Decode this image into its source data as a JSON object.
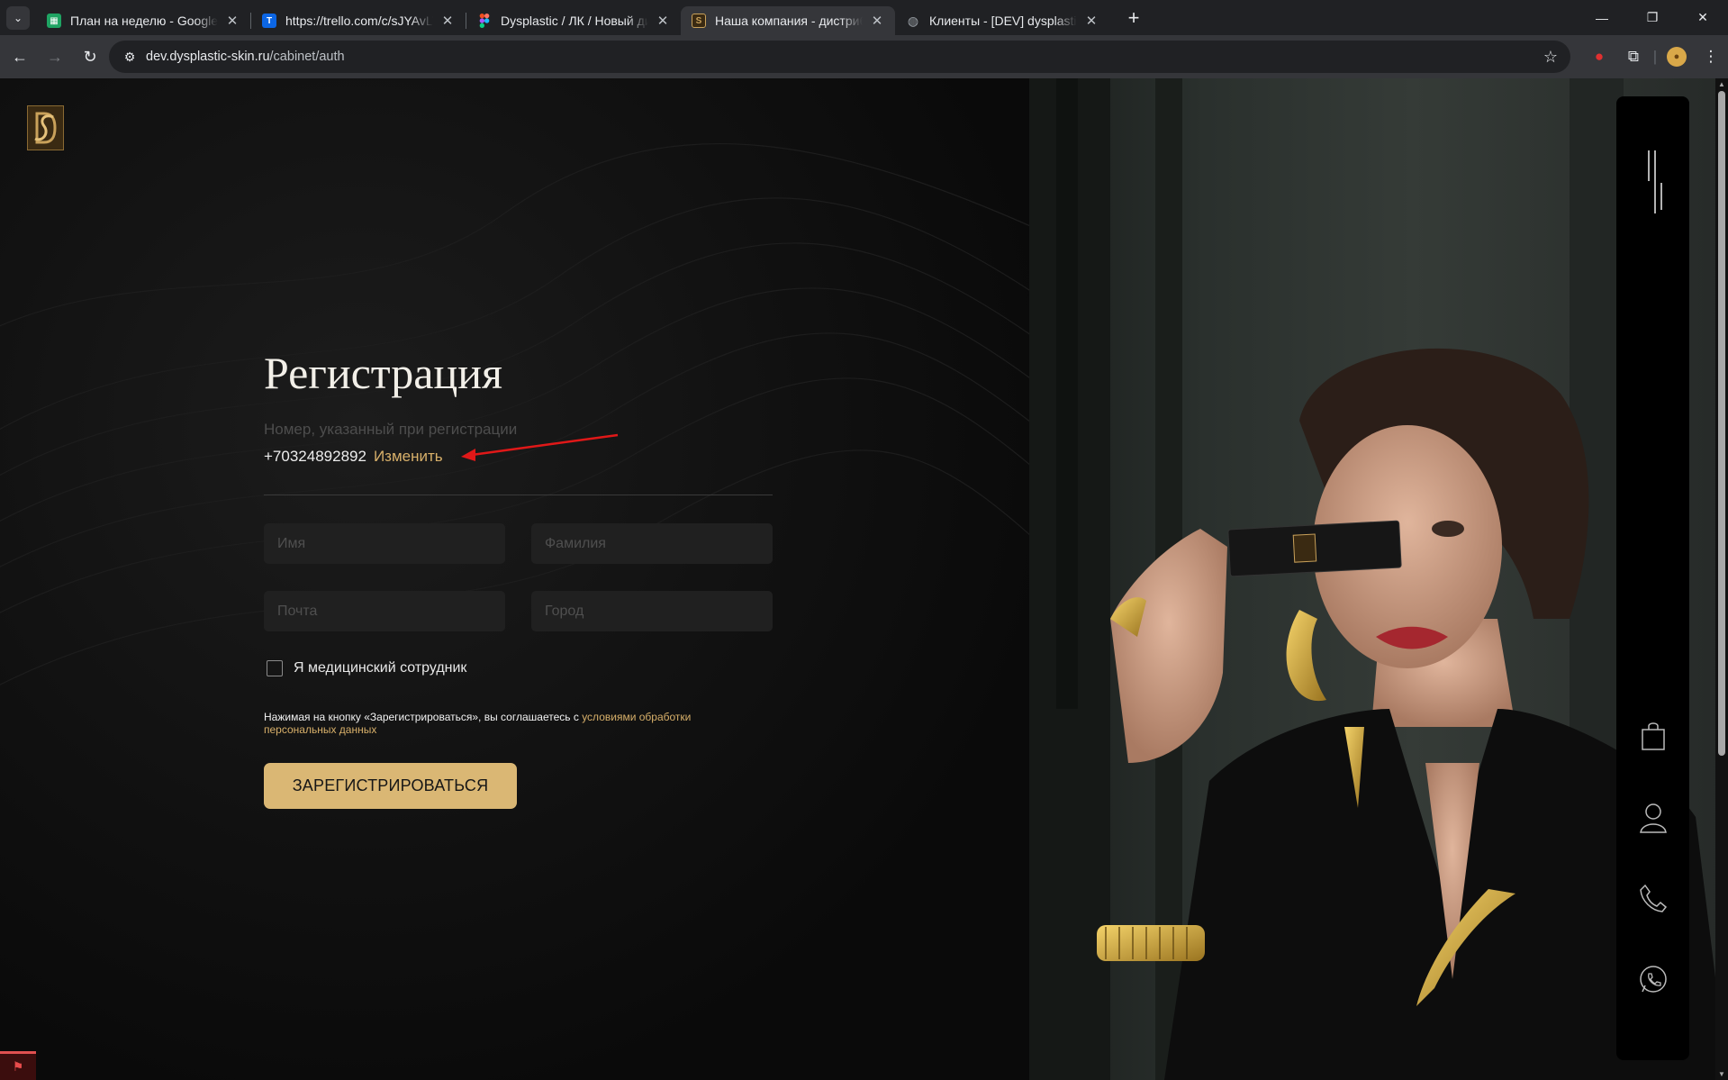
{
  "browser": {
    "tabs": [
      {
        "title": "План на неделю - Google Табл",
        "favicon": "google-sheets-icon",
        "color": "#1fa463",
        "active": false
      },
      {
        "title": "https://trello.com/c/sJYAvLTL на",
        "favicon": "trello-icon",
        "color": "#0c66e4",
        "active": false
      },
      {
        "title": "Dysplastic / ЛК / Новый дизайн",
        "favicon": "figma-icon",
        "color": "#f24e1e",
        "active": false
      },
      {
        "title": "Наша компания - дистрибьют",
        "favicon": "dysplastic-icon",
        "color": "#c9a15a",
        "active": true
      },
      {
        "title": "Клиенты - [DEV] dysplastic-skin",
        "favicon": "globe-icon",
        "color": "#9aa0a6",
        "active": false
      }
    ],
    "url_host": "dev.dysplastic-skin.ru",
    "url_path": "/cabinet/auth"
  },
  "auth": {
    "title": "Регистрация",
    "phone_label": "Номер, указанный при регистрации",
    "phone": "+70324892892",
    "change_link": "Изменить",
    "first_name_placeholder": "Имя",
    "last_name_placeholder": "Фамилия",
    "email_placeholder": "Почта",
    "city_placeholder": "Город",
    "medical_checkbox_label": "Я медицинский сотрудник",
    "medical_checked": false,
    "consent_text": "Нажимая на кнопку «Зарегистрироваться», вы соглашаетесь с ",
    "consent_link": "условиями обработки персональных данных",
    "submit_label": "ЗАРЕГИСТРИРОВАТЬСЯ"
  },
  "colors": {
    "accent_gold": "#dab774",
    "link_gold": "#d8b06a",
    "annotation_arrow": "#e01818"
  },
  "side_panel_icons": [
    "menu-icon",
    "shopping-bag-icon",
    "user-icon",
    "phone-icon",
    "whatsapp-icon"
  ]
}
